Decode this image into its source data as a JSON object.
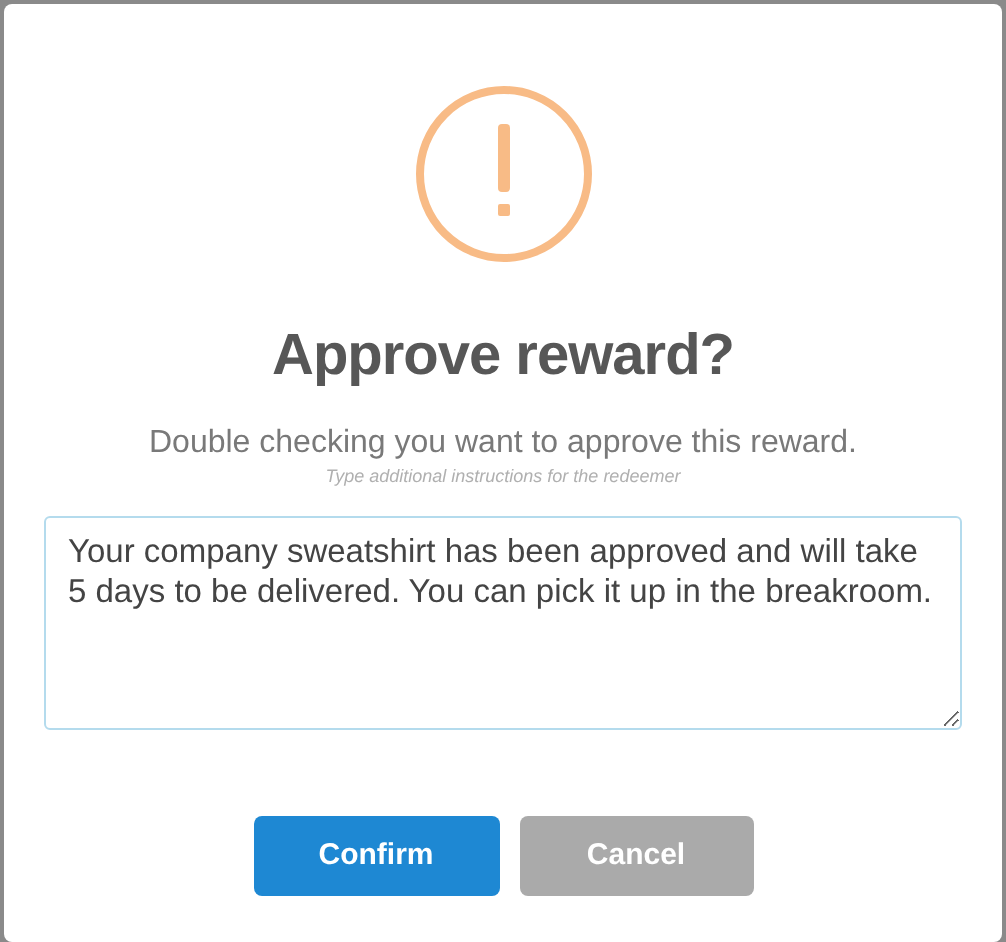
{
  "dialog": {
    "title": "Approve reward?",
    "message": "Double checking you want to approve this reward.",
    "hint": "Type additional instructions for the redeemer",
    "note": {
      "value": "Your company sweatshirt has been approved and will take 5 days to be delivered. You can pick it up in the breakroom. "
    },
    "buttons": [
      {
        "label": "Confirm",
        "kind": "primary"
      },
      {
        "label": "Cancel",
        "kind": "secondary"
      }
    ]
  }
}
